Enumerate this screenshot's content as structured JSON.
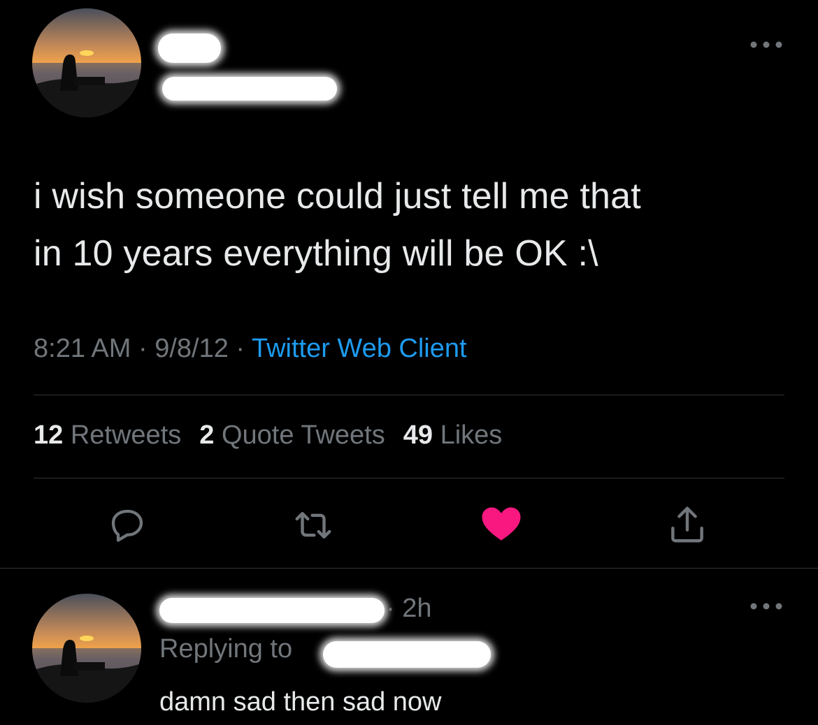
{
  "tweet": {
    "text_line1": "i wish someone could just tell me that",
    "text_line2": "in 10 years everything will be OK :\\",
    "time": "8:21 AM",
    "date": "9/8/12",
    "source": "Twitter Web Client",
    "separator": "·",
    "stats": {
      "retweets_count": "12",
      "retweets_label": "Retweets",
      "quotes_count": "2",
      "quotes_label": "Quote Tweets",
      "likes_count": "49",
      "likes_label": "Likes"
    },
    "actions": {
      "reply_icon": "reply-icon",
      "retweet_icon": "retweet-icon",
      "like_icon": "heart-icon",
      "share_icon": "share-icon",
      "liked": true,
      "like_color": "#f91880"
    }
  },
  "reply": {
    "time_ago": "· 2h",
    "replying_to_label": "Replying to",
    "text": "damn sad then sad now"
  },
  "colors": {
    "background": "#000000",
    "text_primary": "#e7e9ea",
    "text_secondary": "#71767b",
    "link": "#1d9bf0",
    "divider": "#2f3336"
  }
}
